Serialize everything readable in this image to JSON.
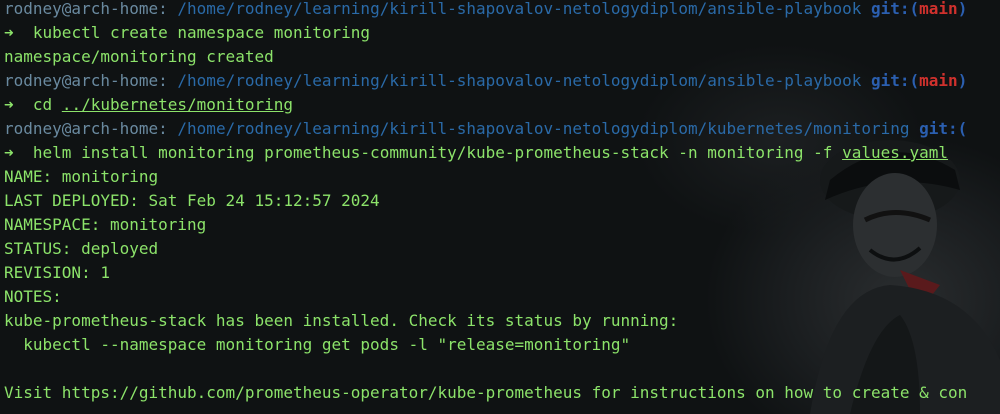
{
  "prompts": [
    {
      "user": "rodney@arch-home:",
      "path": "/home/rodney/learning/kirill-shapovalov-netologydiplom/ansible-playbook",
      "git_label": "git:(",
      "branch": "main",
      "close": ")"
    },
    {
      "user": "rodney@arch-home:",
      "path": "/home/rodney/learning/kirill-shapovalov-netologydiplom/ansible-playbook",
      "git_label": "git:(",
      "branch": "main",
      "close": ")"
    },
    {
      "user": "rodney@arch-home:",
      "path": "/home/rodney/learning/kirill-shapovalov-netologydiplom/kubernetes/monitoring",
      "git_label": "git:(",
      "branch": "",
      "close": ""
    }
  ],
  "arrow": "➜",
  "commands": {
    "c1": "kubectl create namespace monitoring",
    "c2_prefix": "cd ",
    "c2_arg": "../kubernetes/monitoring",
    "c3_prefix": "helm install monitoring prometheus-community/kube-prometheus-stack -n monitoring -f ",
    "c3_arg": "values.yaml"
  },
  "output": {
    "o1": "namespace/monitoring created",
    "name": "NAME: monitoring",
    "deployed": "LAST DEPLOYED: Sat Feb 24 15:12:57 2024",
    "namespace": "NAMESPACE: monitoring",
    "status": "STATUS: deployed",
    "revision": "REVISION: 1",
    "notes": "NOTES:",
    "installed": "kube-prometheus-stack has been installed. Check its status by running:",
    "check_cmd": "  kubectl --namespace monitoring get pods -l \"release=monitoring\"",
    "visit": "Visit https://github.com/prometheus-operator/kube-prometheus for instructions on how to create & con"
  },
  "colors": {
    "text": "#8ce36a",
    "user": "#6a8aa0",
    "path": "#2a6aa8",
    "git": "#2b5fb0",
    "branch": "#d0312d",
    "background": "#0f1213"
  }
}
